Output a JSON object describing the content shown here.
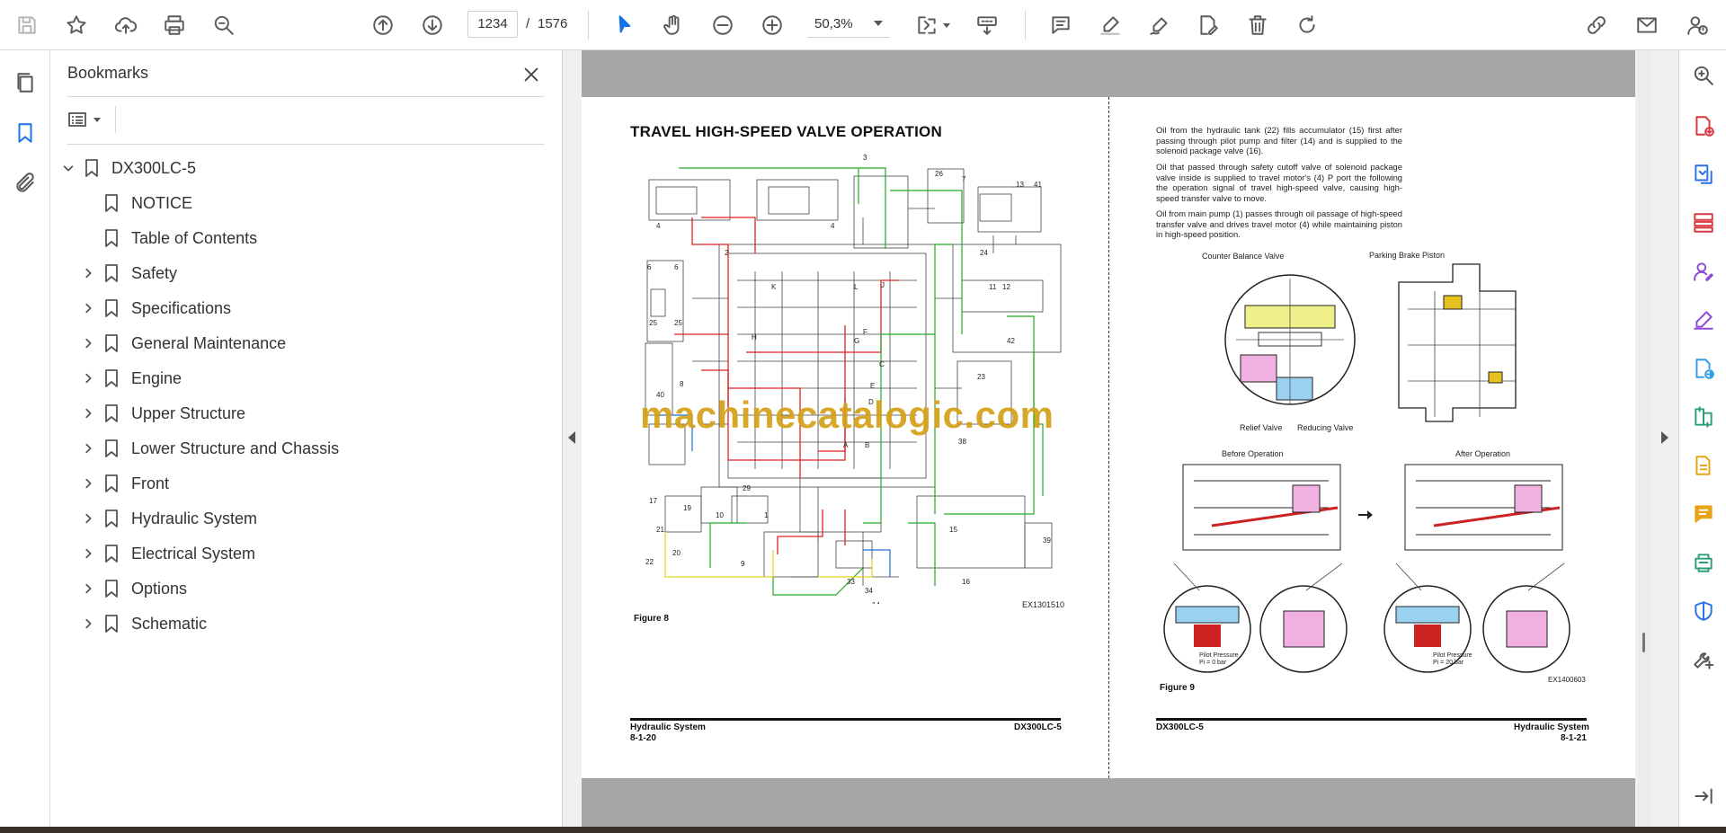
{
  "toolbar": {
    "current_page": "1234",
    "page_separator": "/",
    "total_pages": "1576",
    "zoom": "50,3%"
  },
  "bookmarks": {
    "title": "Bookmarks",
    "root": "DX300LC-5",
    "items": [
      {
        "label": "NOTICE",
        "expandable": false
      },
      {
        "label": "Table of Contents",
        "expandable": false
      },
      {
        "label": "Safety",
        "expandable": true
      },
      {
        "label": "Specifications",
        "expandable": true
      },
      {
        "label": "General Maintenance",
        "expandable": true
      },
      {
        "label": "Engine",
        "expandable": true
      },
      {
        "label": "Upper Structure",
        "expandable": true
      },
      {
        "label": "Lower Structure and Chassis",
        "expandable": true
      },
      {
        "label": "Front",
        "expandable": true
      },
      {
        "label": "Hydraulic System",
        "expandable": true
      },
      {
        "label": "Electrical System",
        "expandable": true
      },
      {
        "label": "Options",
        "expandable": true
      },
      {
        "label": "Schematic",
        "expandable": true
      }
    ]
  },
  "document": {
    "left_page": {
      "heading": "TRAVEL HIGH-SPEED VALVE OPERATION",
      "figure_label": "Figure 8",
      "figure_code": "EX1301510",
      "footer_left_title": "Hydraulic System",
      "footer_left_page": "8-1-20",
      "footer_right": "DX300LC-5"
    },
    "right_page": {
      "paragraphs": [
        "Oil from the hydraulic tank (22) fills accumulator (15) first after passing through pilot pump and filter (14) and is supplied to the solenoid package valve (16).",
        "Oil that passed through safety cutoff valve of solenoid package valve inside is supplied to travel motor's (4) P port the following the operation signal of travel high-speed valve, causing high-speed transfer valve to move.",
        "Oil from main pump (1) passes through oil passage of high-speed transfer valve and drives travel motor (4) while maintaining piston in high-speed position."
      ],
      "labels": {
        "counter_balance": "Counter Balance Valve",
        "parking_brake": "Parking Brake Piston",
        "relief": "Relief Valve",
        "reducing": "Reducing Valve",
        "before": "Before Operation",
        "after": "After Operation",
        "pilot_before": "Pilot Pressure\nPi = 0 bar",
        "pilot_after": "Pilot Pressure\nPi = 20 bar"
      },
      "figure_label": "Figure 9",
      "figure_code": "EX1400603",
      "footer_left": "DX300LC-5",
      "footer_right_title": "Hydraulic System",
      "footer_right_page": "8-1-21"
    },
    "watermark": "machinecatalogic.com"
  },
  "colors": {
    "accent_blue": "#1473e6",
    "watermark": "#d4a017",
    "rail_red": "#d7373f",
    "rail_purple": "#8d48d8",
    "rail_blue": "#2d9de6",
    "rail_green": "#2d9d78",
    "rail_yellow": "#e8a317"
  }
}
